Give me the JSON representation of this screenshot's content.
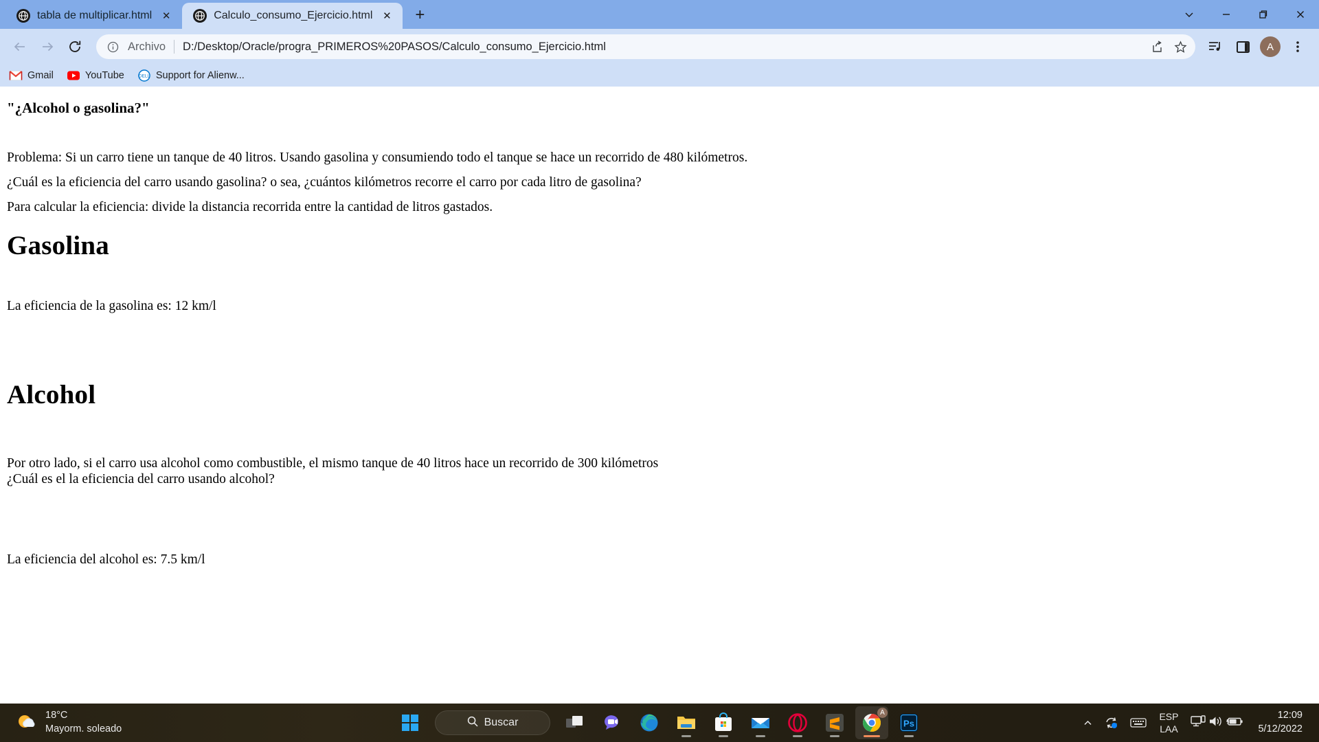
{
  "browser": {
    "tabs": [
      {
        "title": "tabla de multiplicar.html",
        "active": false,
        "favicon": "globe-icon",
        "close_label": "✕"
      },
      {
        "title": "Calculo_consumo_Ejercicio.html",
        "active": true,
        "favicon": "globe-icon",
        "close_label": "✕"
      }
    ],
    "new_tab_label": "+",
    "window_controls": {
      "tab_search": "chevron-down-icon",
      "minimize": "minimize-icon",
      "restore": "restore-icon",
      "close": "close-icon"
    },
    "toolbar": {
      "back": "back-arrow-icon",
      "forward": "forward-arrow-icon",
      "reload": "reload-icon",
      "omnibox": {
        "info_icon": "info-circle-icon",
        "scheme_label": "Archivo",
        "url": "D:/Desktop/Oracle/progra_PRIMEROS%20PASOS/Calculo_consumo_Ejercicio.html",
        "share_icon": "share-icon",
        "bookmark_icon": "star-icon"
      },
      "media_icon": "media-playlist-icon",
      "side_panel_icon": "side-panel-icon",
      "profile_initial": "A",
      "menu_icon": "three-dots-vertical-icon"
    },
    "bookmarks": [
      {
        "label": "Gmail",
        "icon": "gmail-icon"
      },
      {
        "label": "YouTube",
        "icon": "youtube-icon"
      },
      {
        "label": "Support for Alienw...",
        "icon": "dell-icon"
      }
    ]
  },
  "page": {
    "heading_quote": "\"¿Alcohol o gasolina?\"",
    "problem": "Problema: Si un carro tiene un tanque de 40 litros. Usando gasolina y consumiendo todo el tanque se hace un recorrido de 480 kilómetros.",
    "question_gas": "¿Cuál es la eficiencia del carro usando gasolina? o sea, ¿cuántos kilómetros recorre el carro por cada litro de gasolina?",
    "formula_note": "Para calcular la eficiencia: divide la distancia recorrida entre la cantidad de litros gastados.",
    "section_gasolina": "Gasolina",
    "result_gasolina": "La eficiencia de la gasolina es: 12 km/l",
    "section_alcohol": "Alcohol",
    "alcohol_line1": "Por otro lado, si el carro usa alcohol como combustible, el mismo tanque de 40 litros hace un recorrido de 300 kilómetros",
    "alcohol_line2": "¿Cuál es el la eficiencia del carro usando alcohol?",
    "result_alcohol": "La eficiencia del alcohol es: 7.5 km/l"
  },
  "taskbar": {
    "weather": {
      "temperature": "18°C",
      "condition": "Mayorm. soleado",
      "icon": "sun-cloud-icon"
    },
    "start_label": "start-button",
    "search": {
      "label": "Buscar",
      "icon": "search-icon"
    },
    "apps": [
      {
        "name": "task-view",
        "icon": "task-view-icon",
        "running": false,
        "active": false
      },
      {
        "name": "chat",
        "icon": "chat-icon",
        "running": false,
        "active": false
      },
      {
        "name": "edge",
        "icon": "edge-icon",
        "running": false,
        "active": false
      },
      {
        "name": "file-explorer",
        "icon": "folder-icon",
        "running": true,
        "active": false
      },
      {
        "name": "microsoft-store",
        "icon": "store-icon",
        "running": true,
        "active": false
      },
      {
        "name": "mail",
        "icon": "mail-icon",
        "running": true,
        "active": false
      },
      {
        "name": "opera",
        "icon": "opera-icon",
        "running": true,
        "active": false
      },
      {
        "name": "sublime-text",
        "icon": "sublime-icon",
        "running": true,
        "active": false
      },
      {
        "name": "chrome",
        "icon": "chrome-icon",
        "running": true,
        "active": true
      },
      {
        "name": "photoshop",
        "icon": "photoshop-icon",
        "running": true,
        "active": false
      }
    ],
    "tray": {
      "overflow_icon": "chevron-up-icon",
      "onedrive_icon": "onedrive-sync-icon",
      "keyboard_icon": "keyboard-icon",
      "language_line1": "ESP",
      "language_line2": "LAA",
      "network_icon": "network-icon",
      "volume_icon": "volume-icon",
      "battery_icon": "battery-charging-icon",
      "time": "12:09",
      "date": "5/12/2022"
    }
  },
  "colors": {
    "tabstrip": "#82abe8",
    "toolbar": "#cfdff7",
    "page_bg": "#ffffff",
    "taskbar": "#231f12",
    "avatar": "#8d6e5c"
  }
}
